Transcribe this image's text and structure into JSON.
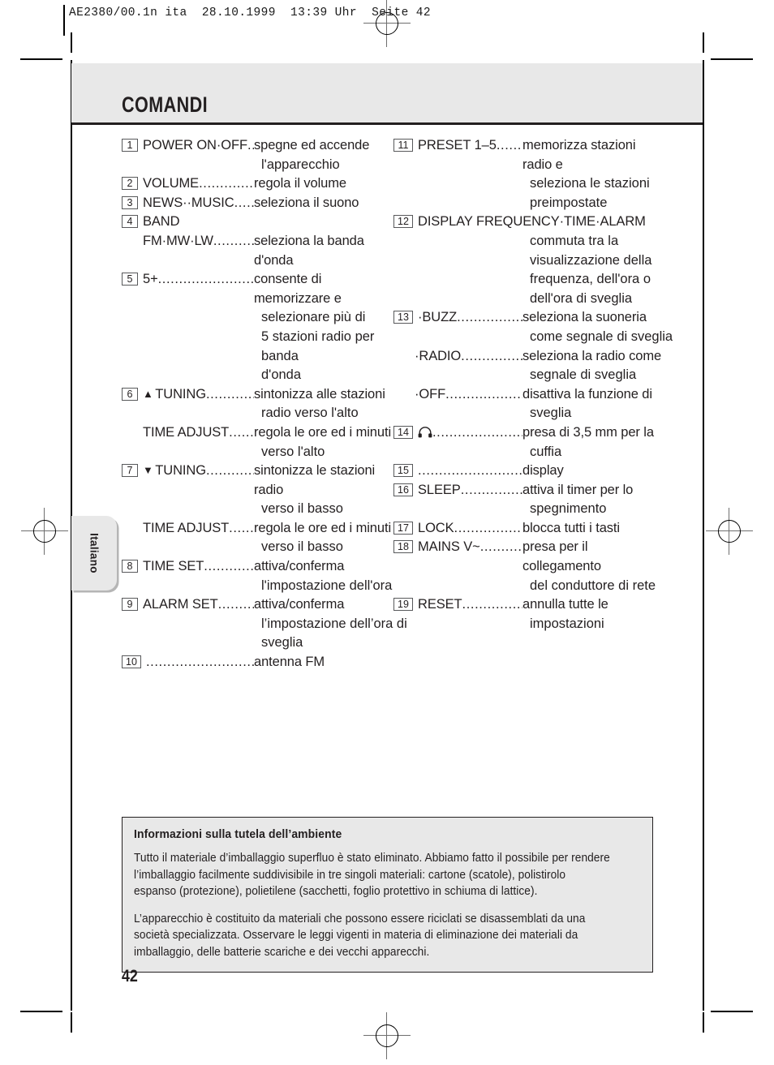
{
  "film_header": "AE2380/00.1n ita  28.10.1999  13:39 Uhr  Seite 42",
  "title": "COMANDI",
  "language_tab": "Italiano",
  "page_number": "42",
  "leader_dots": "..........................................................",
  "left_column": [
    {
      "num": "1",
      "label": "POWER ON·OFF",
      "desc": "spegne ed accende",
      "cont": [
        "l'apparecchio"
      ]
    },
    {
      "num": "2",
      "label": "VOLUME",
      "desc": "regola il volume",
      "cont": []
    },
    {
      "num": "3",
      "label": "NEWS··MUSIC",
      "desc": "seleziona il suono",
      "cont": []
    },
    {
      "num": "4",
      "head": "BAND",
      "label": "FM·MW·LW",
      "desc": "seleziona la banda d'onda",
      "cont": []
    },
    {
      "num": "5",
      "label": "5+",
      "desc": "consente di memorizzare e",
      "cont": [
        "selezionare più di",
        "5 stazioni radio per banda",
        "d'onda"
      ]
    },
    {
      "num": "6",
      "icon": "up-arrow",
      "label": "TUNING",
      "desc": "sintonizza alle stazioni",
      "cont": [
        "radio verso l'alto"
      ]
    },
    {
      "num": "",
      "label": "TIME ADJUST",
      "desc": "regola le ore ed i minuti",
      "cont": [
        "verso l'alto"
      ]
    },
    {
      "num": "7",
      "icon": "down-arrow",
      "label": "TUNING",
      "desc": "sintonizza le stazioni radio",
      "cont": [
        "verso il basso"
      ]
    },
    {
      "num": "",
      "label": "TIME ADJUST",
      "desc": "regola le ore ed i minuti",
      "cont": [
        "verso il basso"
      ]
    },
    {
      "num": "8",
      "label": "TIME SET",
      "desc": "attiva/conferma",
      "cont": [
        "l'impostazione dell'ora"
      ]
    },
    {
      "num": "9",
      "label": "ALARM SET",
      "desc": "attiva/conferma",
      "cont": [
        "l’impostazione dell’ora di",
        "sveglia"
      ]
    },
    {
      "num": "10",
      "label": "",
      "desc": "antenna FM",
      "cont": []
    }
  ],
  "right_column": [
    {
      "num": "11",
      "label": "PRESET 1–5",
      "desc": "memorizza stazioni radio e",
      "cont": [
        "seleziona le stazioni",
        "preimpostate"
      ]
    },
    {
      "num": "12",
      "wide_label": "DISPLAY FREQUENCY·TIME·ALARM",
      "cont": [
        "commuta tra la",
        "visualizzazione della",
        "frequenza, dell'ora o",
        "dell'ora di sveglia"
      ]
    },
    {
      "num": "13",
      "label": "·BUZZ",
      "desc": "seleziona la suoneria",
      "cont": [
        "come segnale di sveglia"
      ]
    },
    {
      "num": "",
      "label": "·RADIO",
      "desc": "seleziona la radio come",
      "cont": [
        "segnale di sveglia"
      ]
    },
    {
      "num": "",
      "label": "·OFF",
      "desc": "disattiva la funzione di",
      "cont": [
        "sveglia"
      ]
    },
    {
      "num": "14",
      "icon": "headphone",
      "label": "",
      "desc": "presa di 3,5 mm per la",
      "cont": [
        "cuffia"
      ]
    },
    {
      "num": "15",
      "label": "",
      "desc": "display",
      "cont": []
    },
    {
      "num": "16",
      "label": "SLEEP",
      "desc": "attiva il timer per lo",
      "cont": [
        "spegnimento"
      ]
    },
    {
      "num": "17",
      "label": "LOCK",
      "desc": "blocca tutti i tasti",
      "cont": []
    },
    {
      "num": "18",
      "label": "MAINS V~",
      "desc": "presa per il collegamento",
      "cont": [
        "del conduttore di rete"
      ]
    },
    {
      "num": "19",
      "label": "RESET",
      "desc": "annulla tutte le",
      "cont": [
        "impostazioni"
      ]
    }
  ],
  "env_box": {
    "heading": "Informazioni sulla tutela dell’ambiente",
    "paragraphs": [
      "Tutto il materiale d’imballaggio superfluo è stato eliminato. Abbiamo fatto il possibile per rendere l’imballaggio facilmente suddivisibile in tre singoli materiali: cartone (scatole), polistirolo espanso (protezione), polietilene (sacchetti, foglio protettivo in schiuma di lattice).",
      "L’apparecchio è costituito da materiali che possono essere riciclati se disassemblati da una società specializzata. Osservare le leggi vigenti in materia di eliminazione dei materiali da imballaggio, delle batterie scariche e dei vecchi apparecchi."
    ]
  },
  "colors": {
    "band_gray": "#e8e8e8",
    "ink": "#231f20",
    "rule": "#58595b"
  }
}
